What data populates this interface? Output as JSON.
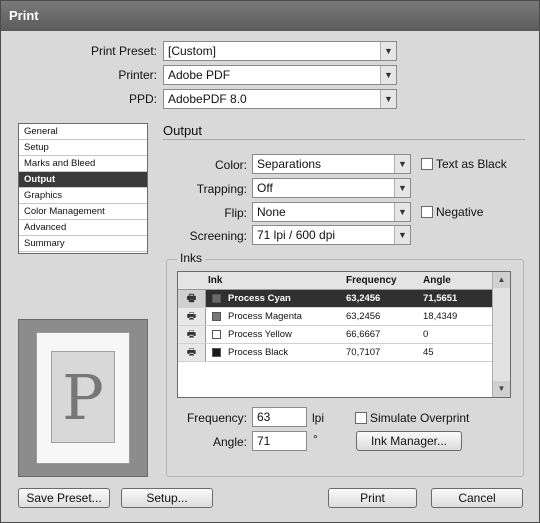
{
  "window": {
    "title": "Print"
  },
  "top": {
    "preset_label": "Print Preset:",
    "preset_value": "[Custom]",
    "printer_label": "Printer:",
    "printer_value": "Adobe PDF",
    "ppd_label": "PPD:",
    "ppd_value": "AdobePDF 8.0"
  },
  "sidebar": {
    "items": [
      "General",
      "Setup",
      "Marks and Bleed",
      "Output",
      "Graphics",
      "Color Management",
      "Advanced",
      "Summary"
    ],
    "selected": "Output"
  },
  "preview": {
    "letter": "P"
  },
  "output": {
    "section_title": "Output",
    "color_label": "Color:",
    "color_value": "Separations",
    "text_as_black_label": "Text as Black",
    "trapping_label": "Trapping:",
    "trapping_value": "Off",
    "flip_label": "Flip:",
    "flip_value": "None",
    "negative_label": "Negative",
    "screening_label": "Screening:",
    "screening_value": "71 lpi / 600 dpi"
  },
  "inks": {
    "group_title": "Inks",
    "headers": {
      "ink": "Ink",
      "frequency": "Frequency",
      "angle": "Angle"
    },
    "rows": [
      {
        "name": "Process Cyan",
        "frequency": "63,2456",
        "angle": "71,5651",
        "swatch": "#6a6a6a",
        "selected": true
      },
      {
        "name": "Process Magenta",
        "frequency": "63,2456",
        "angle": "18,4349",
        "swatch": "#777777",
        "selected": false
      },
      {
        "name": "Process Yellow",
        "frequency": "66,6667",
        "angle": "0",
        "swatch": "#ffffff",
        "selected": false
      },
      {
        "name": "Process Black",
        "frequency": "70,7107",
        "angle": "45",
        "swatch": "#1a1a1a",
        "selected": false
      }
    ]
  },
  "screen": {
    "frequency_label": "Frequency:",
    "frequency_value": "63",
    "frequency_unit": "lpi",
    "angle_label": "Angle:",
    "angle_value": "71",
    "angle_unit": "°",
    "simulate_overprint_label": "Simulate Overprint",
    "ink_manager_label": "Ink Manager..."
  },
  "buttons": {
    "save_preset": "Save Preset...",
    "setup": "Setup...",
    "print": "Print",
    "cancel": "Cancel"
  },
  "colors": {
    "titlebar": "#666666",
    "selection": "#303030",
    "dialog_bg": "#d9d9d9"
  }
}
